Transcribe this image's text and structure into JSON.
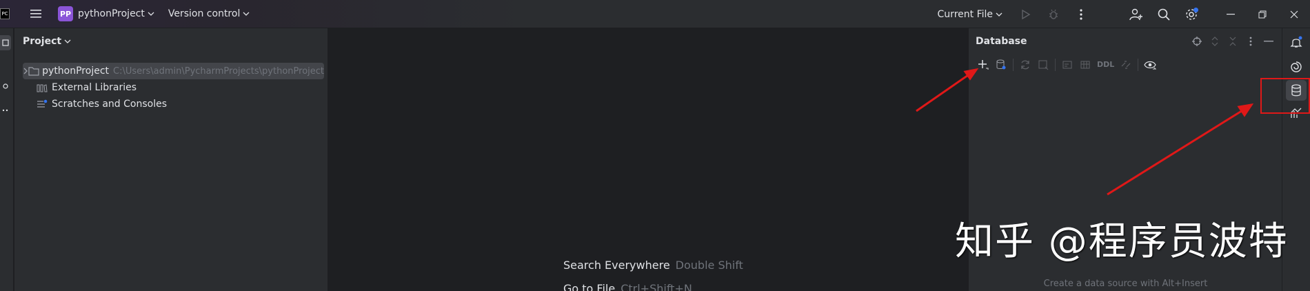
{
  "titlebar": {
    "app_logo_text": "PC",
    "project_badge": "PP",
    "project_name": "pythonProject",
    "version_control": "Version control",
    "run_config": "Current File"
  },
  "project_panel": {
    "title": "Project",
    "tree": [
      {
        "label": "pythonProject",
        "path": "C:\\Users\\admin\\PycharmProjects\\pythonProject",
        "icon": "folder-icon",
        "expandable": true
      },
      {
        "label": "External Libraries",
        "icon": "library-icon"
      },
      {
        "label": "Scratches and Consoles",
        "icon": "scratches-icon"
      }
    ]
  },
  "editor": {
    "hints": [
      {
        "label": "Search Everywhere",
        "key": "Double Shift"
      },
      {
        "label": "Go to File",
        "key": "Ctrl+Shift+N"
      }
    ]
  },
  "database_panel": {
    "title": "Database",
    "ddl_label": "DDL",
    "empty_text": "Create a data source with Alt+Insert"
  },
  "watermark": "知乎 @程序员波特",
  "colors": {
    "accent": "#8b55d8",
    "annotation": "#e01818",
    "panel_bg": "#2b2d30",
    "editor_bg": "#1e1f22"
  }
}
